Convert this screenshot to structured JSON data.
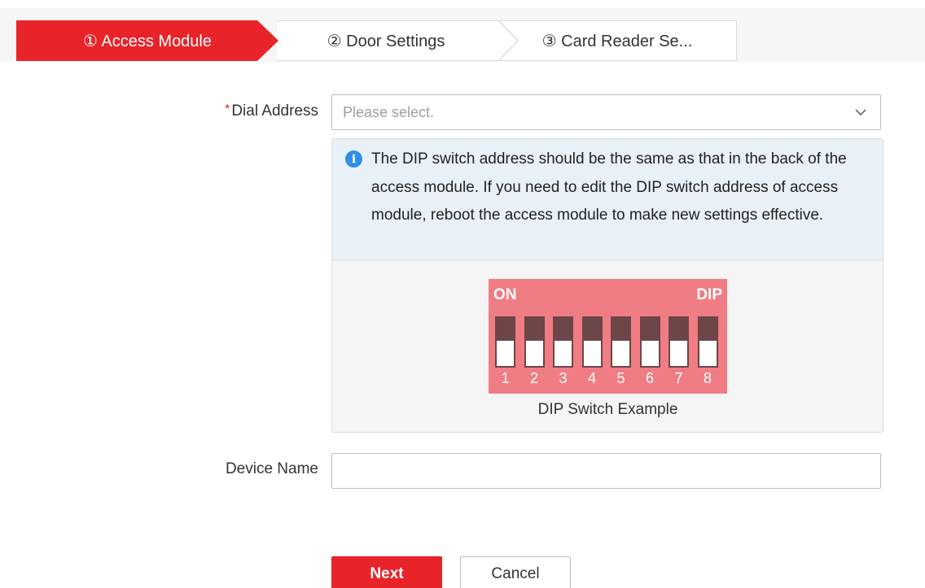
{
  "steps": [
    {
      "label": "① Access Module",
      "active": true
    },
    {
      "label": "② Door Settings",
      "active": false
    },
    {
      "label": "③ Card Reader Se...",
      "active": false
    }
  ],
  "form": {
    "dial_address": {
      "required_mark": "*",
      "label": "Dial Address",
      "placeholder": "Please select."
    },
    "info": {
      "icon": "info-icon",
      "text": "The DIP switch address should be the same as that in the back of the access module. If you need to edit the DIP switch address of access module, reboot the access module to make new settings effective."
    },
    "dip_example": {
      "on_label": "ON",
      "dip_label": "DIP",
      "switches": [
        "1",
        "2",
        "3",
        "4",
        "5",
        "6",
        "7",
        "8"
      ],
      "caption": "DIP Switch Example"
    },
    "device_name": {
      "label": "Device Name",
      "value": ""
    }
  },
  "buttons": {
    "next": "Next",
    "cancel": "Cancel"
  },
  "colors": {
    "accent": "#e8242a",
    "info_bg": "#e8f0f8",
    "dip_bg": "#f07d84"
  }
}
